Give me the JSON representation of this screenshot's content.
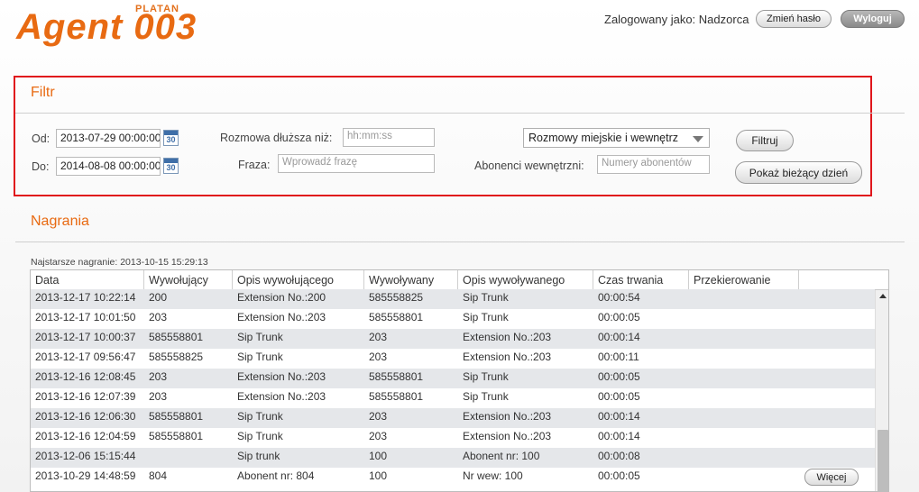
{
  "header": {
    "logo_brand": "PLATAN",
    "logo_name": "Agent 003",
    "logged_in": "Zalogowany jako: Nadzorca",
    "change_password": "Zmień hasło",
    "logout": "Wyloguj"
  },
  "filter": {
    "title": "Filtr",
    "from_label": "Od:",
    "from_value": "2013-07-29 00:00:00",
    "to_label": "Do:",
    "to_value": "2014-08-08 00:00:00",
    "calendar_day": "30",
    "duration_label": "Rozmowa dłuższa niż:",
    "duration_placeholder": "hh:mm:ss",
    "phrase_label": "Fraza:",
    "phrase_placeholder": "Wprowadź frazę",
    "call_type_selected": "Rozmowy miejskie i wewnętrz",
    "subscribers_label": "Abonenci wewnętrzni:",
    "subscribers_placeholder": "Numery abonentów",
    "filter_button": "Filtruj",
    "today_button": "Pokaż bieżący dzień"
  },
  "recordings": {
    "title": "Nagrania",
    "oldest": "Najstarsze nagranie: 2013-10-15 15:29:13",
    "columns": [
      "Data",
      "Wywołujący",
      "Opis wywołującego",
      "Wywoływany",
      "Opis wywoływanego",
      "Czas trwania",
      "Przekierowanie"
    ],
    "rows": [
      [
        "2013-12-17 10:22:14",
        "200",
        "Extension No.:200",
        "585558825",
        "Sip Trunk",
        "00:00:54",
        ""
      ],
      [
        "2013-12-17 10:01:50",
        "203",
        "Extension No.:203",
        "585558801",
        "Sip Trunk",
        "00:00:05",
        ""
      ],
      [
        "2013-12-17 10:00:37",
        "585558801",
        "Sip Trunk",
        "203",
        "Extension No.:203",
        "00:00:14",
        ""
      ],
      [
        "2013-12-17 09:56:47",
        "585558825",
        "Sip Trunk",
        "203",
        "Extension No.:203",
        "00:00:11",
        ""
      ],
      [
        "2013-12-16 12:08:45",
        "203",
        "Extension No.:203",
        "585558801",
        "Sip Trunk",
        "00:00:05",
        ""
      ],
      [
        "2013-12-16 12:07:39",
        "203",
        "Extension No.:203",
        "585558801",
        "Sip Trunk",
        "00:00:05",
        ""
      ],
      [
        "2013-12-16 12:06:30",
        "585558801",
        "Sip Trunk",
        "203",
        "Extension No.:203",
        "00:00:14",
        ""
      ],
      [
        "2013-12-16 12:04:59",
        "585558801",
        "Sip Trunk",
        "203",
        "Extension No.:203",
        "00:00:14",
        ""
      ],
      [
        "2013-12-06 15:15:44",
        "",
        "Sip trunk",
        "100",
        "Abonent nr: 100",
        "00:00:08",
        ""
      ],
      [
        "2013-10-29 14:48:59",
        "804",
        "Abonent nr: 804",
        "100",
        "Nr wew: 100",
        "00:00:05",
        ""
      ]
    ],
    "more_button": "Więcej"
  }
}
